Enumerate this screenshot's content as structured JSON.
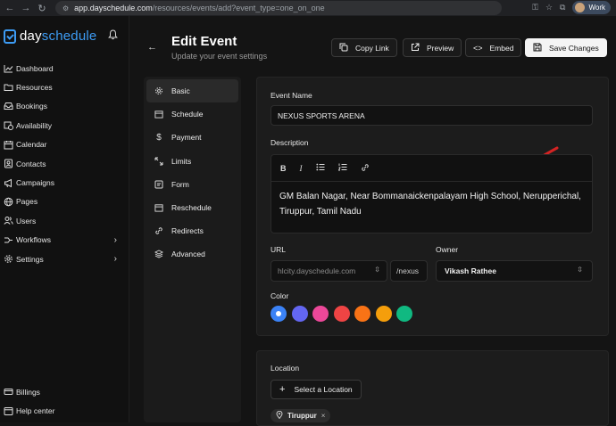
{
  "browser": {
    "url_host": "app.dayschedule.com",
    "url_path": "/resources/events/add?event_type=one_on_one",
    "profile_label": "Work"
  },
  "brand": {
    "name_part1": "day",
    "name_part2": "schedule",
    "accent_color": "#3d9cf5"
  },
  "sidebar": {
    "items": [
      {
        "label": "Dashboard",
        "icon": "chart-line-icon"
      },
      {
        "label": "Resources",
        "icon": "folder-icon"
      },
      {
        "label": "Bookings",
        "icon": "inbox-icon"
      },
      {
        "label": "Availability",
        "icon": "calendar-clock-icon"
      },
      {
        "label": "Calendar",
        "icon": "calendar-icon"
      },
      {
        "label": "Contacts",
        "icon": "contacts-icon"
      },
      {
        "label": "Campaigns",
        "icon": "megaphone-icon"
      },
      {
        "label": "Pages",
        "icon": "globe-icon"
      },
      {
        "label": "Users",
        "icon": "users-icon"
      },
      {
        "label": "Workflows",
        "icon": "workflow-icon"
      },
      {
        "label": "Settings",
        "icon": "gear-icon"
      }
    ],
    "bottom_items": [
      {
        "label": "Billings",
        "icon": "billing-icon"
      },
      {
        "label": "Help center",
        "icon": "help-icon"
      }
    ]
  },
  "header": {
    "title": "Edit Event",
    "subtitle": "Update your event settings",
    "buttons": {
      "copy_link": "Copy Link",
      "preview": "Preview",
      "embed": "Embed",
      "save": "Save Changes"
    }
  },
  "tabs": [
    {
      "label": "Basic",
      "icon": "gear-icon"
    },
    {
      "label": "Schedule",
      "icon": "calendar-icon"
    },
    {
      "label": "Payment",
      "icon": "dollar-icon"
    },
    {
      "label": "Limits",
      "icon": "limits-icon"
    },
    {
      "label": "Form",
      "icon": "form-icon"
    },
    {
      "label": "Reschedule",
      "icon": "calendar-icon"
    },
    {
      "label": "Redirects",
      "icon": "link-icon"
    },
    {
      "label": "Advanced",
      "icon": "layers-icon"
    }
  ],
  "form": {
    "event_name_label": "Event Name",
    "event_name_value": "NEXUS SPORTS ARENA",
    "description_label": "Description",
    "description_line1": "GM Balan Nagar, Near Bommanaickenpalayam High School, Nerupperichal,",
    "description_line2": "Tiruppur, Tamil Nadu",
    "url_label": "URL",
    "url_domain": "hlcity.dayschedule.com",
    "url_slug": "/nexus",
    "owner_label": "Owner",
    "owner_value": "Vikash Rathee",
    "color_label": "Color",
    "colors": [
      "#3b82f6",
      "#6366f1",
      "#ec4899",
      "#ef4444",
      "#f97316",
      "#f59e0b",
      "#10b981"
    ]
  },
  "location": {
    "label": "Location",
    "select_button": "Select a Location",
    "chip_label": "Tiruppur"
  }
}
